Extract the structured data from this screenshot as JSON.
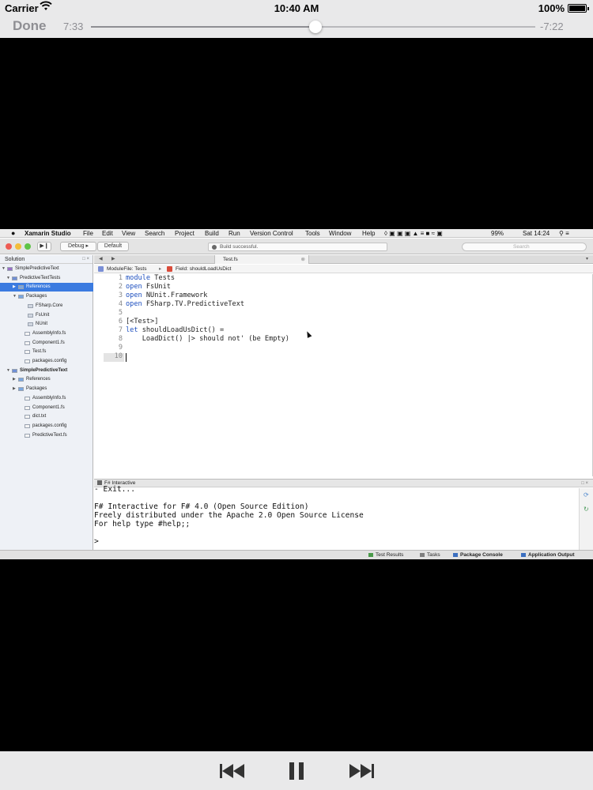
{
  "status_bar": {
    "carrier": "Carrier",
    "wifi_icon": "wifi-icon",
    "time": "10:40 AM",
    "battery": "100%"
  },
  "player": {
    "done_label": "Done",
    "elapsed": "7:33",
    "remaining": "-7:22",
    "progress": 0.506,
    "controls": [
      "rewind-icon",
      "pause-icon",
      "fast-forward-icon"
    ]
  },
  "ide": {
    "menubar": {
      "app": "Xamarin Studio",
      "items": [
        "File",
        "Edit",
        "View",
        "Search",
        "Project",
        "Build",
        "Run",
        "Version Control",
        "Tools",
        "Window",
        "Help"
      ],
      "battery": "99%",
      "clock": "Sat 14:24"
    },
    "toolbar": {
      "config": "Debug",
      "target": "Default",
      "build_status": "Build successful.",
      "search_placeholder": "Search"
    },
    "solution_pad": {
      "title": "Solution",
      "controls": "□ ×",
      "tree": [
        {
          "label": "SimplePredictiveText",
          "type": "solution"
        },
        {
          "label": "PredictiveTextTests",
          "type": "project"
        },
        {
          "label": "References",
          "type": "folder",
          "selected": true
        },
        {
          "label": "Packages",
          "type": "folder"
        },
        {
          "label": "FSharp.Core",
          "type": "package"
        },
        {
          "label": "FsUnit",
          "type": "package"
        },
        {
          "label": "NUnit",
          "type": "package"
        },
        {
          "label": "AssemblyInfo.fs",
          "type": "file"
        },
        {
          "label": "Component1.fs",
          "type": "file"
        },
        {
          "label": "Test.fs",
          "type": "file"
        },
        {
          "label": "packages.config",
          "type": "file"
        },
        {
          "label": "SimplePredictiveText",
          "type": "project"
        },
        {
          "label": "References",
          "type": "folder"
        },
        {
          "label": "Packages",
          "type": "folder"
        },
        {
          "label": "AssemblyInfo.fs",
          "type": "file"
        },
        {
          "label": "Component1.fs",
          "type": "file"
        },
        {
          "label": "dict.txt",
          "type": "file"
        },
        {
          "label": "packages.config",
          "type": "file"
        },
        {
          "label": "PredictiveText.fs",
          "type": "file"
        }
      ]
    },
    "editor_tab": {
      "label": "Test.fs",
      "close": "⊗"
    },
    "breadcrumb": {
      "module": "ModuleFile: Tests",
      "field": "Field: shouldLoadUsDict"
    },
    "code": [
      {
        "n": "1",
        "text": "module Tests"
      },
      {
        "n": "2",
        "text": "open FsUnit"
      },
      {
        "n": "3",
        "text": "open NUnit.Framework"
      },
      {
        "n": "4",
        "text": "open FSharp.TV.PredictiveText"
      },
      {
        "n": "5",
        "text": ""
      },
      {
        "n": "6",
        "text": "[<Test>]"
      },
      {
        "n": "7",
        "text": "let shouldLoadUsDict() ="
      },
      {
        "n": "8",
        "text": "    LoadDict() |> should not' (be Empty)"
      },
      {
        "n": "9",
        "text": ""
      },
      {
        "n": "10",
        "text": ""
      }
    ],
    "fsi": {
      "title": "F# Interactive",
      "lines": [
        "- Exit...",
        "",
        "F# Interactive for F# 4.0 (Open Source Edition)",
        "Freely distributed under the Apache 2.0 Open Source License",
        "For help type #help;;",
        "",
        ">"
      ]
    },
    "bottom_pads": [
      "Test Results",
      "Tasks",
      "Package Console",
      "Application Output"
    ]
  }
}
